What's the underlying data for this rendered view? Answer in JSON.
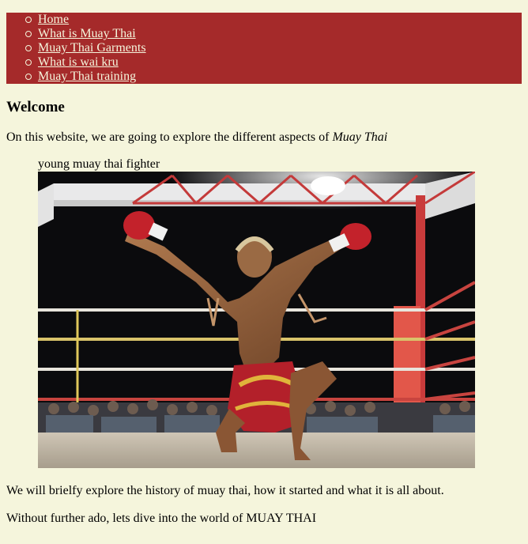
{
  "nav": {
    "items": [
      {
        "label": "Home"
      },
      {
        "label": "What is Muay Thai"
      },
      {
        "label": "Muay Thai Garments"
      },
      {
        "label": "What is wai kru"
      },
      {
        "label": "Muay Thai training"
      }
    ]
  },
  "main": {
    "heading": "Welcome",
    "intro_prefix": "On this website, we are going to explore the different aspects of ",
    "intro_emphasis": "Muay Thai",
    "figure_caption": "young muay thai fighter",
    "history_text": "We will brielfy explore the history of muay thai, how it started and what it is all about.",
    "closing_text": "Without further ado, lets dive into the world of MUAY THAI"
  },
  "colors": {
    "page_background": "#f5f5dc",
    "nav_background": "#a52a2a",
    "nav_link": "#f5f5dc"
  }
}
